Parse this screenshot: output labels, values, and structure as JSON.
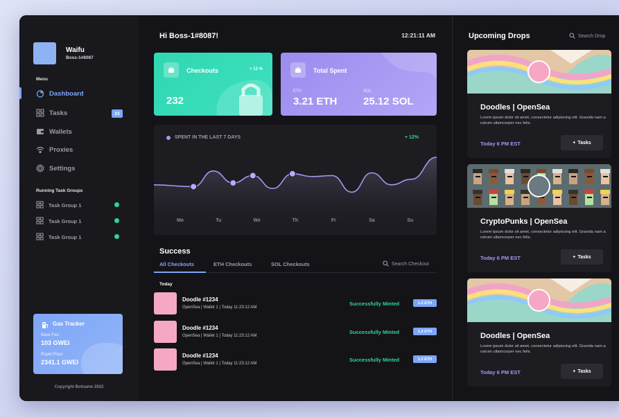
{
  "window": {
    "traffic_colors": [
      "#ff5f57",
      "#febc2e",
      "#28c840"
    ]
  },
  "sidebar": {
    "user": {
      "name": "Waifu",
      "handle": "Boss-1#8087"
    },
    "menu_label": "Menu",
    "items": [
      {
        "label": "Dashboard",
        "icon": "pie-chart-icon",
        "active": true
      },
      {
        "label": "Tasks",
        "icon": "grid-icon",
        "badge": "23"
      },
      {
        "label": "Wallets",
        "icon": "wallet-icon"
      },
      {
        "label": "Proxies",
        "icon": "wifi-icon"
      },
      {
        "label": "Settings",
        "icon": "gear-icon"
      }
    ],
    "groups_label": "Running Task Groups",
    "groups": [
      {
        "label": "Task Group 1",
        "status_color": "#2fd39b"
      },
      {
        "label": "Task Group 1",
        "status_color": "#2fd39b"
      },
      {
        "label": "Task Group 1",
        "status_color": "#2fd39b"
      }
    ],
    "gas": {
      "title": "Gas Tracker",
      "base_label": "Base Fee:",
      "base_value": "103 GWEI",
      "rapid_label": "Rapid Price:",
      "rapid_value": "2341.1 GWEI"
    },
    "copyright": "Copyright Botname 2022"
  },
  "header": {
    "greeting": "Hi Boss-1#8087!",
    "time": "12:21:11 AM"
  },
  "cards": {
    "checkouts": {
      "title": "Checkouts",
      "change": "+ 12 %",
      "value": "232"
    },
    "spent": {
      "title": "Total Spent",
      "eth_label": "ETH",
      "eth_value": "3.21 ETH",
      "sol_label": "SOL",
      "sol_value": "25.12 SOL"
    }
  },
  "chart": {
    "title": "SPENT IN THE LAST 7 DAYS",
    "change": "+ 12%",
    "line_color": "#a996f4"
  },
  "chart_data": {
    "type": "line",
    "title": "SPENT IN THE LAST 7 DAYS",
    "categories": [
      "Mo",
      "Tu",
      "We",
      "Th",
      "Fr",
      "Sa",
      "Su"
    ],
    "x": [
      0,
      0.5,
      1,
      1.5,
      2,
      2.5,
      3,
      3.5,
      4,
      4.5,
      5,
      5.5,
      6,
      6.5
    ],
    "values": [
      40,
      38,
      55,
      42,
      50,
      36,
      52,
      49,
      50,
      32,
      53,
      40,
      46,
      70
    ],
    "markers_at": [
      1,
      3,
      4,
      6
    ],
    "ylim": [
      0,
      100
    ]
  },
  "success": {
    "title": "Success",
    "tabs": [
      "All Checkouts",
      "ETH Checkouts",
      "SOL Checkouts"
    ],
    "search_placeholder": "Search Checkout",
    "day_label": "Today",
    "rows": [
      {
        "name": "Doodle #1234",
        "meta": "OpenSea | Wallet 1 | Today 11:23:12 AM",
        "status": "Successfully Minted",
        "amount": "1.2 ETH"
      },
      {
        "name": "Doodle #1234",
        "meta": "OpenSea | Wallet 1 | Today 11:23:12 AM",
        "status": "Successfully Minted",
        "amount": "1.2 ETH"
      },
      {
        "name": "Doodle #1234",
        "meta": "OpenSea | Wallet 1 | Today 11:23:12 AM",
        "status": "Successfully Minted",
        "amount": "1.2 ETH"
      }
    ]
  },
  "drops": {
    "title": "Upcoming Drops",
    "search_placeholder": "Search Drop",
    "items": [
      {
        "name": "Doodles |  OpenSea",
        "desc": "Lorem ipsum dolor sit amet, consectetur adipiscing elit. Gravida nam a rutrum ullamcorper nec felis.",
        "time": "Today 6 PM EST",
        "button": "Tasks",
        "banner": "doodles"
      },
      {
        "name": "CryptoPunks |  OpenSea",
        "desc": "Lorem ipsum dolor sit amet, consectetur adipiscing elit. Gravida nam a rutrum ullamcorper nec felis.",
        "time": "Today 6 PM EST",
        "button": "Tasks",
        "banner": "punks"
      },
      {
        "name": "Doodles |  OpenSea",
        "desc": "Lorem ipsum dolor sit amet, consectetur adipiscing elit. Gravida nam a rutrum ullamcorper nec felis.",
        "time": "Today 6 PM EST",
        "button": "Tasks",
        "banner": "doodles"
      }
    ]
  }
}
